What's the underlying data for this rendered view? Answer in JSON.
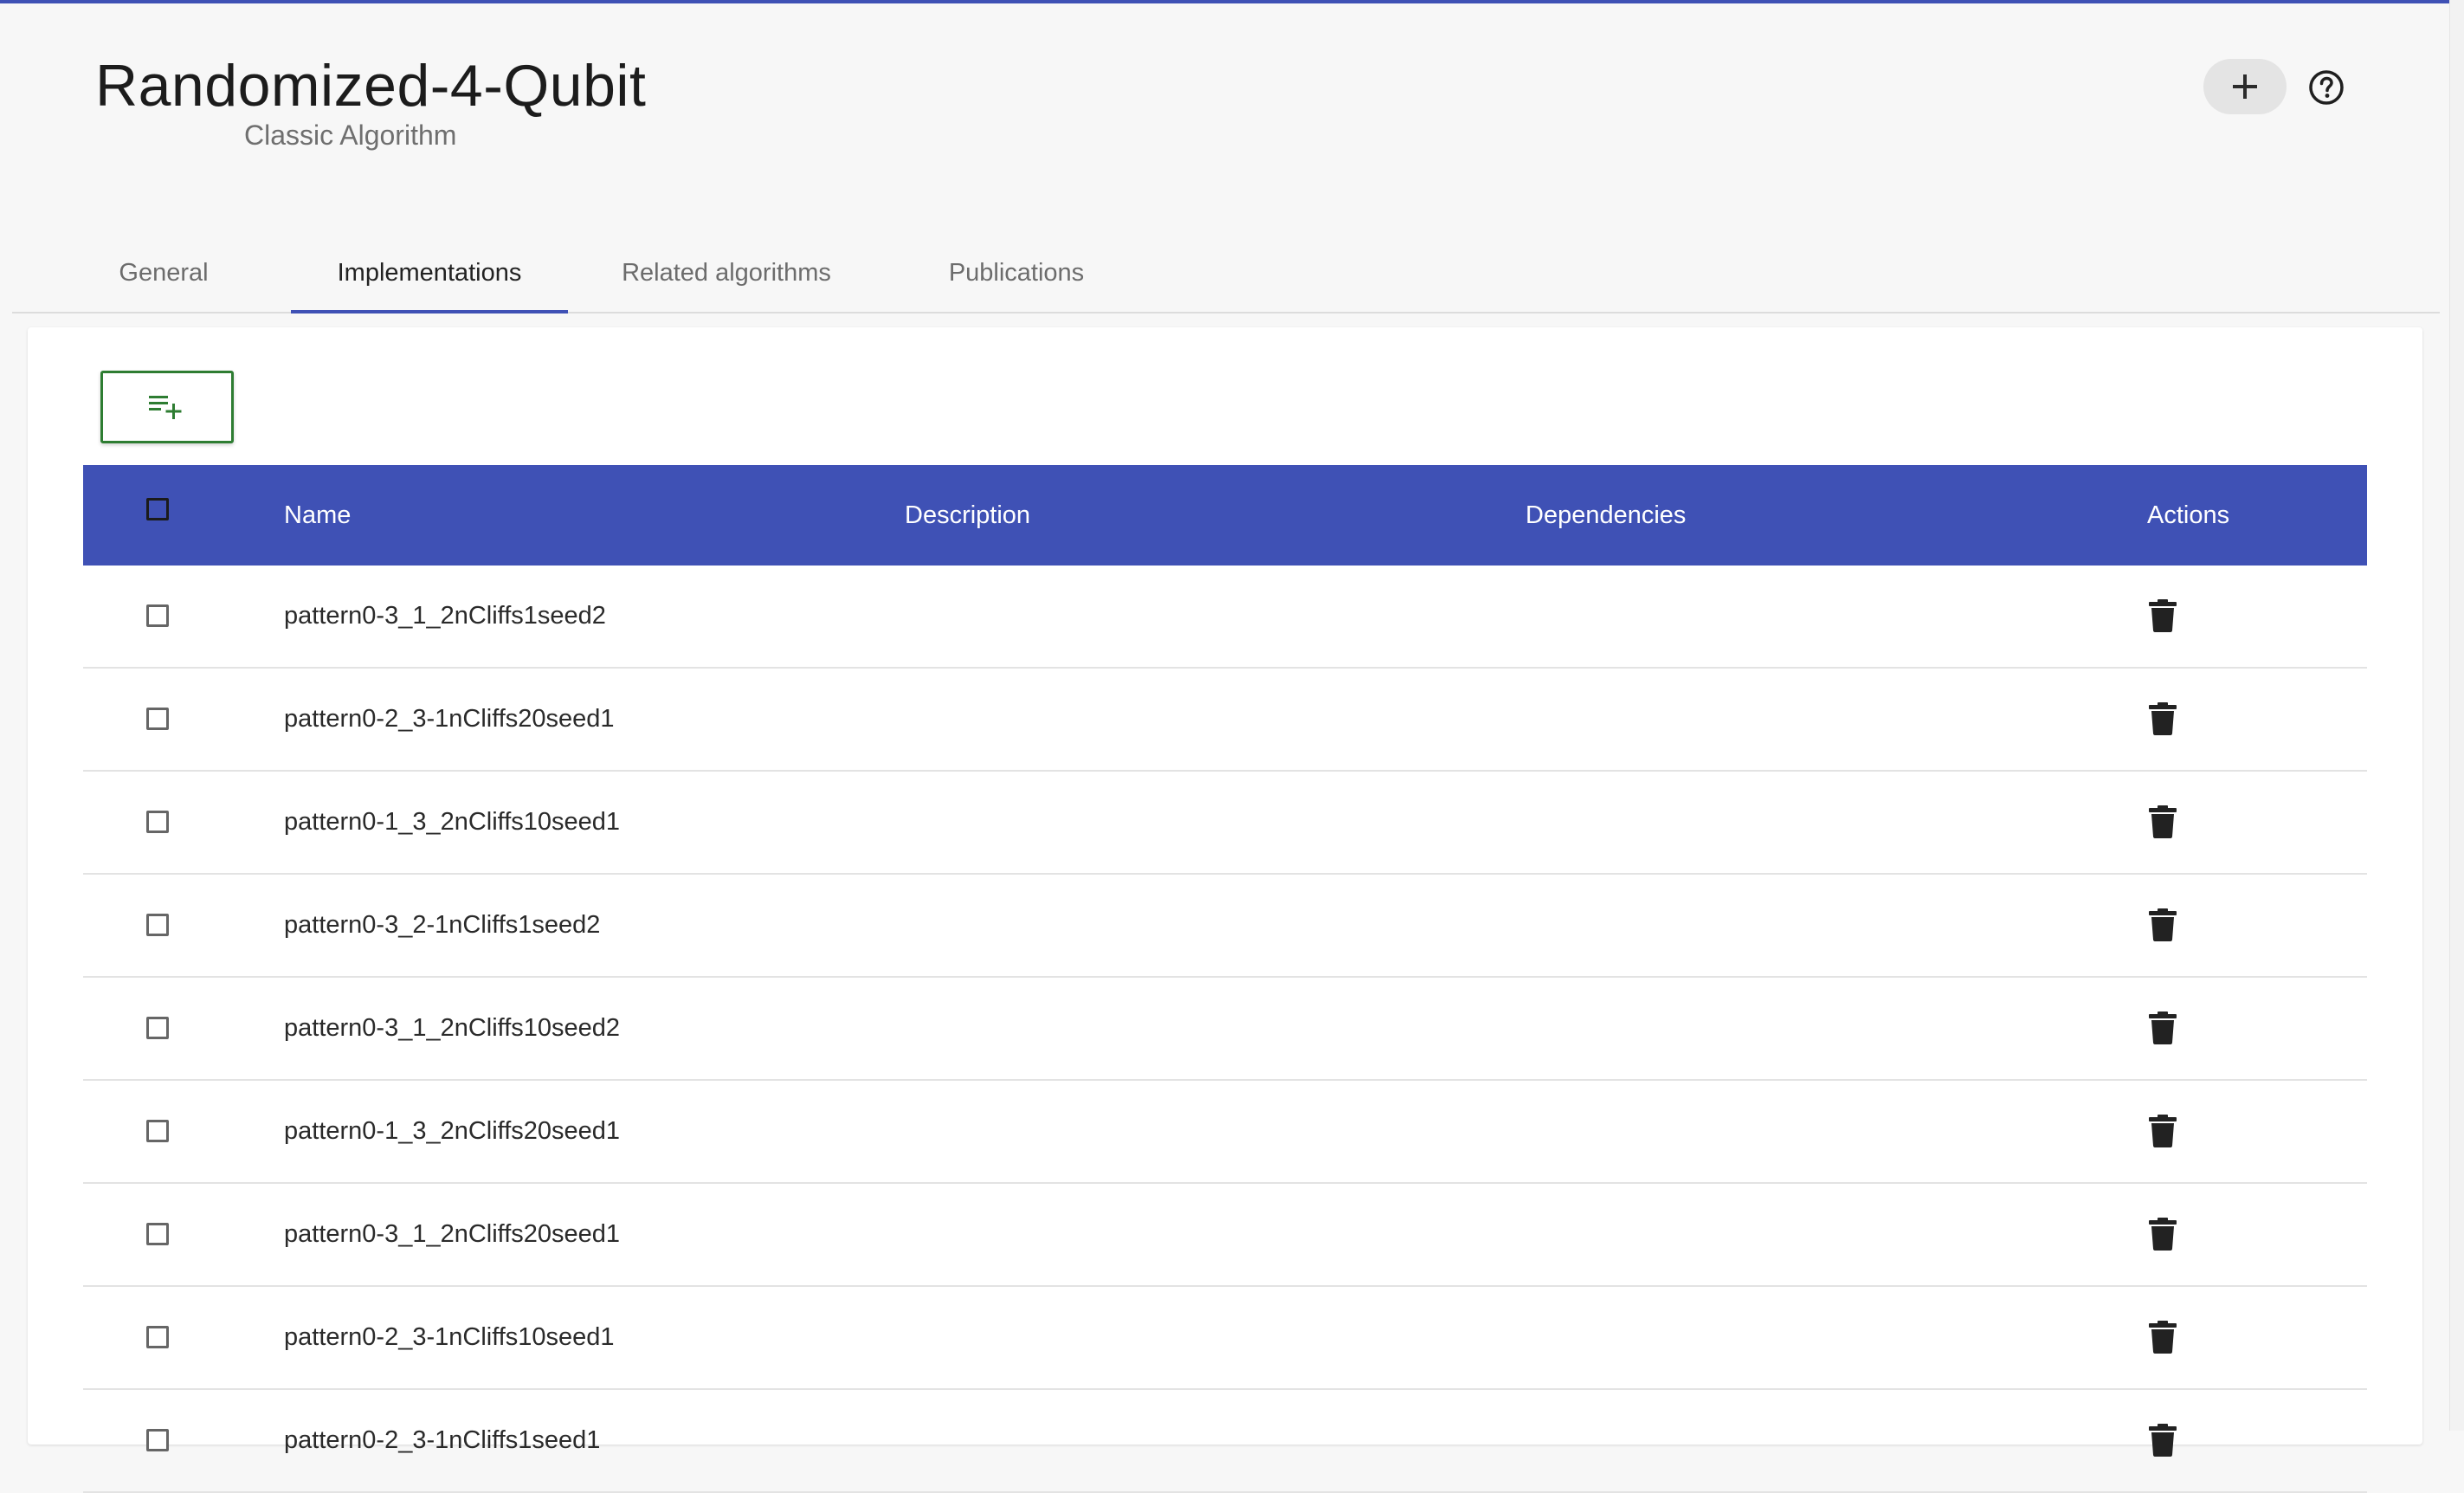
{
  "header": {
    "title": "Randomized-4-Qubit",
    "subtitle": "Classic Algorithm",
    "add_icon": "plus-icon",
    "help_icon": "help-circle-icon"
  },
  "tabs": [
    {
      "label": "General",
      "active": false
    },
    {
      "label": "Implementations",
      "active": true
    },
    {
      "label": "Related algorithms",
      "active": false
    },
    {
      "label": "Publications",
      "active": false
    }
  ],
  "toolbar": {
    "add_icon": "playlist-add-icon",
    "accent": "#2e7d32"
  },
  "table": {
    "header_color": "#3f51b5",
    "columns": [
      "Name",
      "Description",
      "Dependencies",
      "Actions"
    ],
    "action_icon": "trash-icon",
    "rows": [
      {
        "name": "pattern0-3_1_2nCliffs1seed2",
        "description": "",
        "dependencies": ""
      },
      {
        "name": "pattern0-2_3-1nCliffs20seed1",
        "description": "",
        "dependencies": ""
      },
      {
        "name": "pattern0-1_3_2nCliffs10seed1",
        "description": "",
        "dependencies": ""
      },
      {
        "name": "pattern0-3_2-1nCliffs1seed2",
        "description": "",
        "dependencies": ""
      },
      {
        "name": "pattern0-3_1_2nCliffs10seed2",
        "description": "",
        "dependencies": ""
      },
      {
        "name": "pattern0-1_3_2nCliffs20seed1",
        "description": "",
        "dependencies": ""
      },
      {
        "name": "pattern0-3_1_2nCliffs20seed1",
        "description": "",
        "dependencies": ""
      },
      {
        "name": "pattern0-2_3-1nCliffs10seed1",
        "description": "",
        "dependencies": ""
      },
      {
        "name": "pattern0-2_3-1nCliffs1seed1",
        "description": "",
        "dependencies": ""
      }
    ]
  }
}
